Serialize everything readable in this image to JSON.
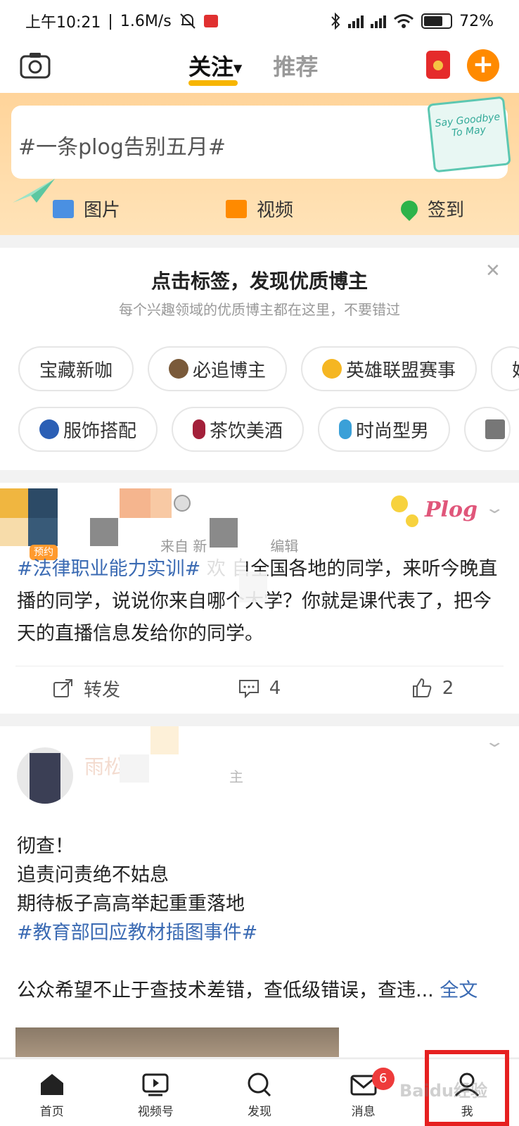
{
  "status_bar": {
    "time": "上午10:21",
    "speed": "1.6M/s",
    "battery": "72",
    "battery_level": 0.72
  },
  "top_nav": {
    "tabs": [
      {
        "label": "关注",
        "active": true
      },
      {
        "label": "推荐",
        "active": false
      }
    ]
  },
  "compose": {
    "placeholder": "#一条plog告别五月#",
    "sticker_text": "Say Goodbye To May",
    "actions": [
      {
        "label": "图片",
        "icon": "image-icon"
      },
      {
        "label": "视频",
        "icon": "video-icon"
      },
      {
        "label": "签到",
        "icon": "location-pin-icon"
      }
    ]
  },
  "recommend": {
    "title": "点击标签，发现优质博主",
    "subtitle": "每个兴趣领域的优质博主都在这里，不要错过",
    "row1": [
      "宝藏新咖",
      "必追博主",
      "英雄联盟赛事",
      "娱"
    ],
    "row2": [
      "服饰搭配",
      "茶饮美酒",
      "时尚型男",
      ""
    ]
  },
  "post1": {
    "badge": "预约",
    "meta_from": "来自 新",
    "meta_edit": "编辑",
    "sticker": "Plog",
    "text_tag": "#法律职业能力实训#",
    "text_body": " 欢  自全国各地的同学，来听今晚直播的同学，说说你来自哪个大学？你就是课代表了，把今天的直播信息发给你的同学。",
    "actions": {
      "repost": "转发",
      "comments": "4",
      "likes": "2"
    }
  },
  "post2": {
    "name_fragment": "雨松-刘",
    "meta_fragment": "主",
    "lines": [
      "彻查！",
      "追责问责绝不姑息",
      "期待板子高高举起重重落地"
    ],
    "tag": "#教育部回应教材插图事件#",
    "last_line": "公众希望不止于查技术差错，查低级错误，查违...",
    "more": "全文"
  },
  "bottom_nav": {
    "items": [
      {
        "label": "首页",
        "icon": "home-icon"
      },
      {
        "label": "视频号",
        "icon": "video-channel-icon"
      },
      {
        "label": "发现",
        "icon": "search-icon"
      },
      {
        "label": "消息",
        "icon": "mail-icon",
        "badge": "6"
      },
      {
        "label": "我",
        "icon": "profile-icon"
      }
    ]
  },
  "watermark": "Baidu经验"
}
